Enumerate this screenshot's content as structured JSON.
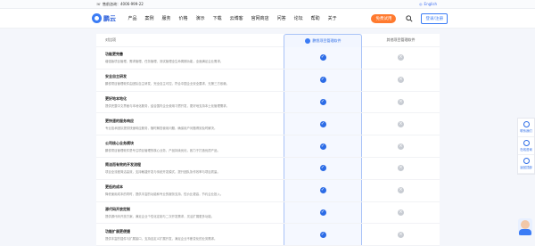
{
  "topbar": {
    "phone_label": "售前咨询：4006-999-22",
    "language": "English"
  },
  "nav": {
    "logo_text": "鹏云",
    "items": [
      "产品",
      "案例",
      "服务",
      "价格",
      "演示",
      "下载",
      "云博客",
      "官网商店",
      "问答",
      "论坛",
      "帮助",
      "关于"
    ],
    "trial_label": "免费试用",
    "login_label": "登录/注册"
  },
  "table": {
    "header_col1": "对比项",
    "header_col2": "鹏悦项目管理软件",
    "header_col3": "其他项目管理软件",
    "rows": [
      {
        "title": "功能更完善",
        "desc": "增强版项目管理、需求管理、任务管理、测试管理全生命周期功能，全面满足企业需求。",
        "ours": "yes",
        "others": "no"
      },
      {
        "title": "安全自主研发",
        "desc": "鹏悦项目管理软件由团队自主研发，完全自主可控，符合中国企业安全要求，无第三方依赖。",
        "ours": "yes",
        "others": "no"
      },
      {
        "title": "更好地本地化",
        "desc": "提供完整中文界面与本地化服务，结合国内企业使用习惯开发，更好地支持本土化管理需求。",
        "ours": "yes",
        "others": "no"
      },
      {
        "title": "更快速的服务响应",
        "desc": "专业技术团队提供快速响应服务，随时解答使用问题，确保用户问题得到及时解决。",
        "ours": "yes",
        "others": "no"
      },
      {
        "title": "公司核心业务模块",
        "desc": "鹏悦项目管理软件是专注项目管理的核心业务，产品持续优化，致力于打造优质产品。",
        "ours": "yes",
        "others": "no"
      },
      {
        "title": "简洁而有效的开发流程",
        "desc": "项目全流程简洁高效，支持敏捷开发与传统开发模式，提升团队协作效率与项目质量。",
        "ours": "yes",
        "others": "no"
      },
      {
        "title": "更低的成本",
        "desc": "降低使用成本的同时，提供丰富的功能和专业的服务支持，性价比更高，节约企业投入。",
        "ours": "yes",
        "others": "no"
      },
      {
        "title": "源代码开放定制",
        "desc": "提供源代码开放方案，满足企业个性化定制与二次开发需求，灵活扩展更多功能。",
        "ours": "yes",
        "others": "no"
      },
      {
        "title": "功能扩展更便捷",
        "desc": "提供丰富的插件与扩展接口，支持自定义扩展开发，满足企业不断变化的业务需求。",
        "ours": "yes",
        "others": "no"
      }
    ]
  },
  "side": {
    "items": [
      "联系我们",
      "在线咨询",
      "返回顶部"
    ]
  }
}
